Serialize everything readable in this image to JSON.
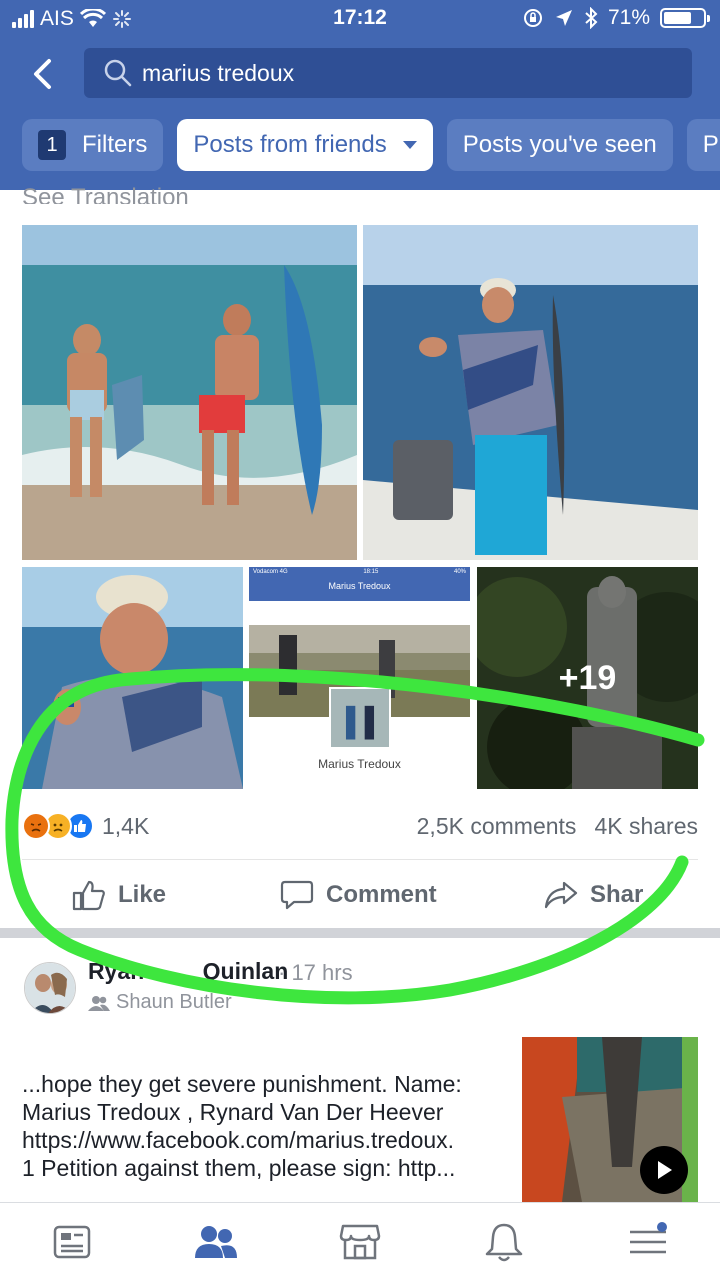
{
  "status_bar": {
    "carrier": "AIS",
    "time": "17:12",
    "battery": "71%",
    "battery_level": 0.71
  },
  "header": {
    "search_query": "marius tredoux",
    "filters_count": "1",
    "chips": [
      "Filters",
      "Posts from friends",
      "Posts you've seen",
      "P"
    ]
  },
  "post1": {
    "see_translation": "See Translation",
    "photos_more": "+19",
    "screenshot_title": "Marius Tredoux",
    "screenshot_status_carrier": "Vodacom 4G",
    "screenshot_status_time": "18:15",
    "screenshot_status_battery": "40%",
    "screenshot_caption": "Marius Tredoux",
    "reaction_count": "1,4K",
    "comments": "2,5K comments",
    "shares": "4K shares",
    "actions": {
      "like": "Like",
      "comment": "Comment",
      "share": "Shar"
    }
  },
  "post2": {
    "author_visible": "Ryan",
    "author_partial": "Quinlan",
    "time": "· 17 hrs",
    "subline": "Shaun Butler",
    "text_lines": [
      "...hope they get severe punishment. Name:",
      "Marius Tredoux , Rynard Van Der Heever",
      "https://www.facebook.com/marius.tredoux.",
      "1 Petition against them, please sign: http..."
    ]
  },
  "bottom_nav": [
    "news-feed-icon",
    "friends-icon",
    "marketplace-icon",
    "notifications-icon",
    "menu-icon"
  ],
  "colors": {
    "brand": "#4267b2",
    "annotation": "#3ee63e",
    "angry": "#e9710f",
    "sad": "#f7b125",
    "like": "#1877f2"
  }
}
